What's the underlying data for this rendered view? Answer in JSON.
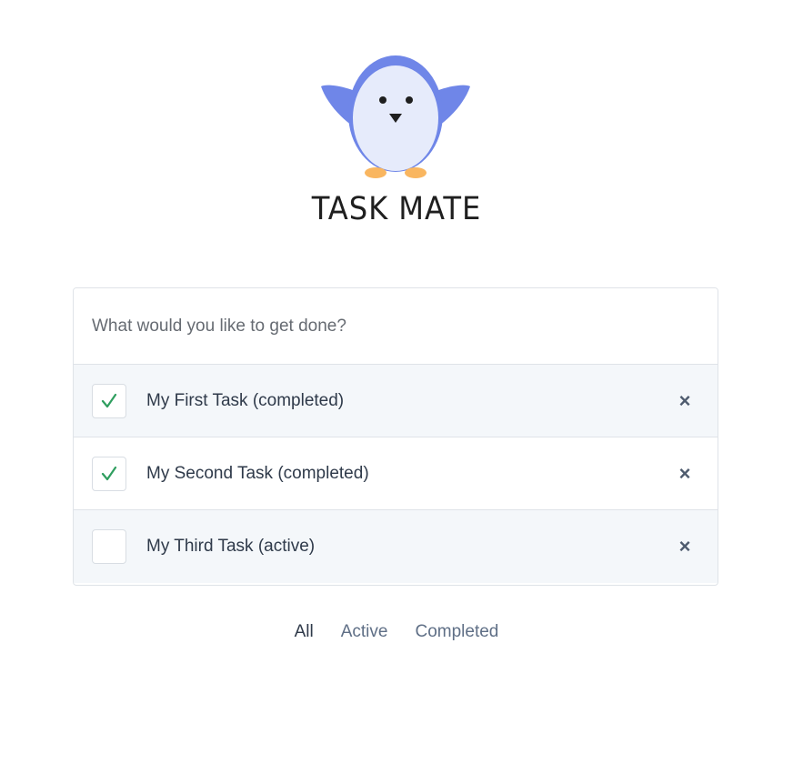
{
  "header": {
    "title": "TASK MATE",
    "logo_icon": "penguin-logo-icon"
  },
  "new_task": {
    "placeholder": "What would you like to get done?",
    "value": ""
  },
  "tasks": [
    {
      "label": "My First Task (completed)",
      "completed": true,
      "delete_icon": "×"
    },
    {
      "label": "My Second Task (completed)",
      "completed": true,
      "delete_icon": "×"
    },
    {
      "label": "My Third Task (active)",
      "completed": false,
      "delete_icon": "×"
    }
  ],
  "filters": {
    "all": "All",
    "active": "Active",
    "completed": "Completed",
    "selected": "all"
  },
  "colors": {
    "penguin_body": "#6f86e8",
    "penguin_belly": "#e6ebfb",
    "penguin_feet": "#f9b660",
    "check_color": "#2f9e5f",
    "row_alt_bg": "#f4f7fa"
  }
}
